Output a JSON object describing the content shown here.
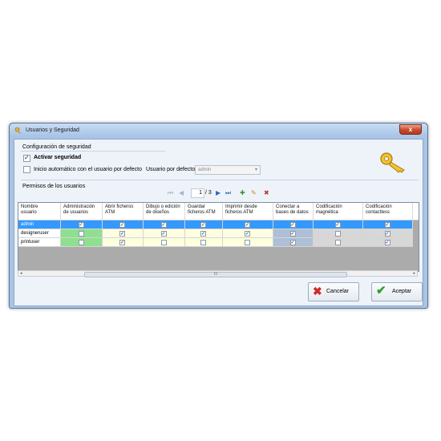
{
  "window": {
    "title": "Usuarios y Seguridad",
    "close_label": "x"
  },
  "security": {
    "group_label": "Configuración de seguridad",
    "activate": {
      "label": "Activar seguridad",
      "checked": true
    },
    "auto_login": {
      "label": "Inicio automático con el usuario por defecto",
      "checked": false
    },
    "default_user_label": "Usuario por defecto:",
    "default_user_value": "admin",
    "key_icon": "key-icon"
  },
  "permissions": {
    "label": "Permisos de los usuarios",
    "pager": {
      "current": "1",
      "total": "/ 3"
    },
    "columns": [
      [
        "Nombre",
        "usuario"
      ],
      [
        "Administración",
        "de usuarios"
      ],
      [
        "Abrir ficheros",
        "ATM"
      ],
      [
        "Dibujo o edición",
        "de diseños"
      ],
      [
        "Guardar",
        "ficheros ATM"
      ],
      [
        "Imprimir desde",
        "ficheros ATM"
      ],
      [
        "Conectar a",
        "bases de datos"
      ],
      [
        "Codificación",
        "magnética"
      ],
      [
        "Codificación",
        "contactless"
      ]
    ],
    "rows": [
      {
        "user": "admin",
        "values": [
          true,
          true,
          true,
          true,
          true,
          true,
          true,
          true
        ]
      },
      {
        "user": "designeruser",
        "values": [
          false,
          true,
          true,
          true,
          true,
          true,
          false,
          true
        ]
      },
      {
        "user": "printuser",
        "values": [
          false,
          true,
          false,
          false,
          false,
          true,
          false,
          true
        ]
      }
    ],
    "scroll_thumb_glyph": "III"
  },
  "buttons": {
    "cancel": "Cancelar",
    "accept": "Aceptar"
  },
  "colors": {
    "selected_row": "#3399ff",
    "admin_col": "#8ee08e",
    "db_col": "#aebfd6",
    "light_col": "#ffffe0",
    "gray_col": "#d7d7d7"
  }
}
